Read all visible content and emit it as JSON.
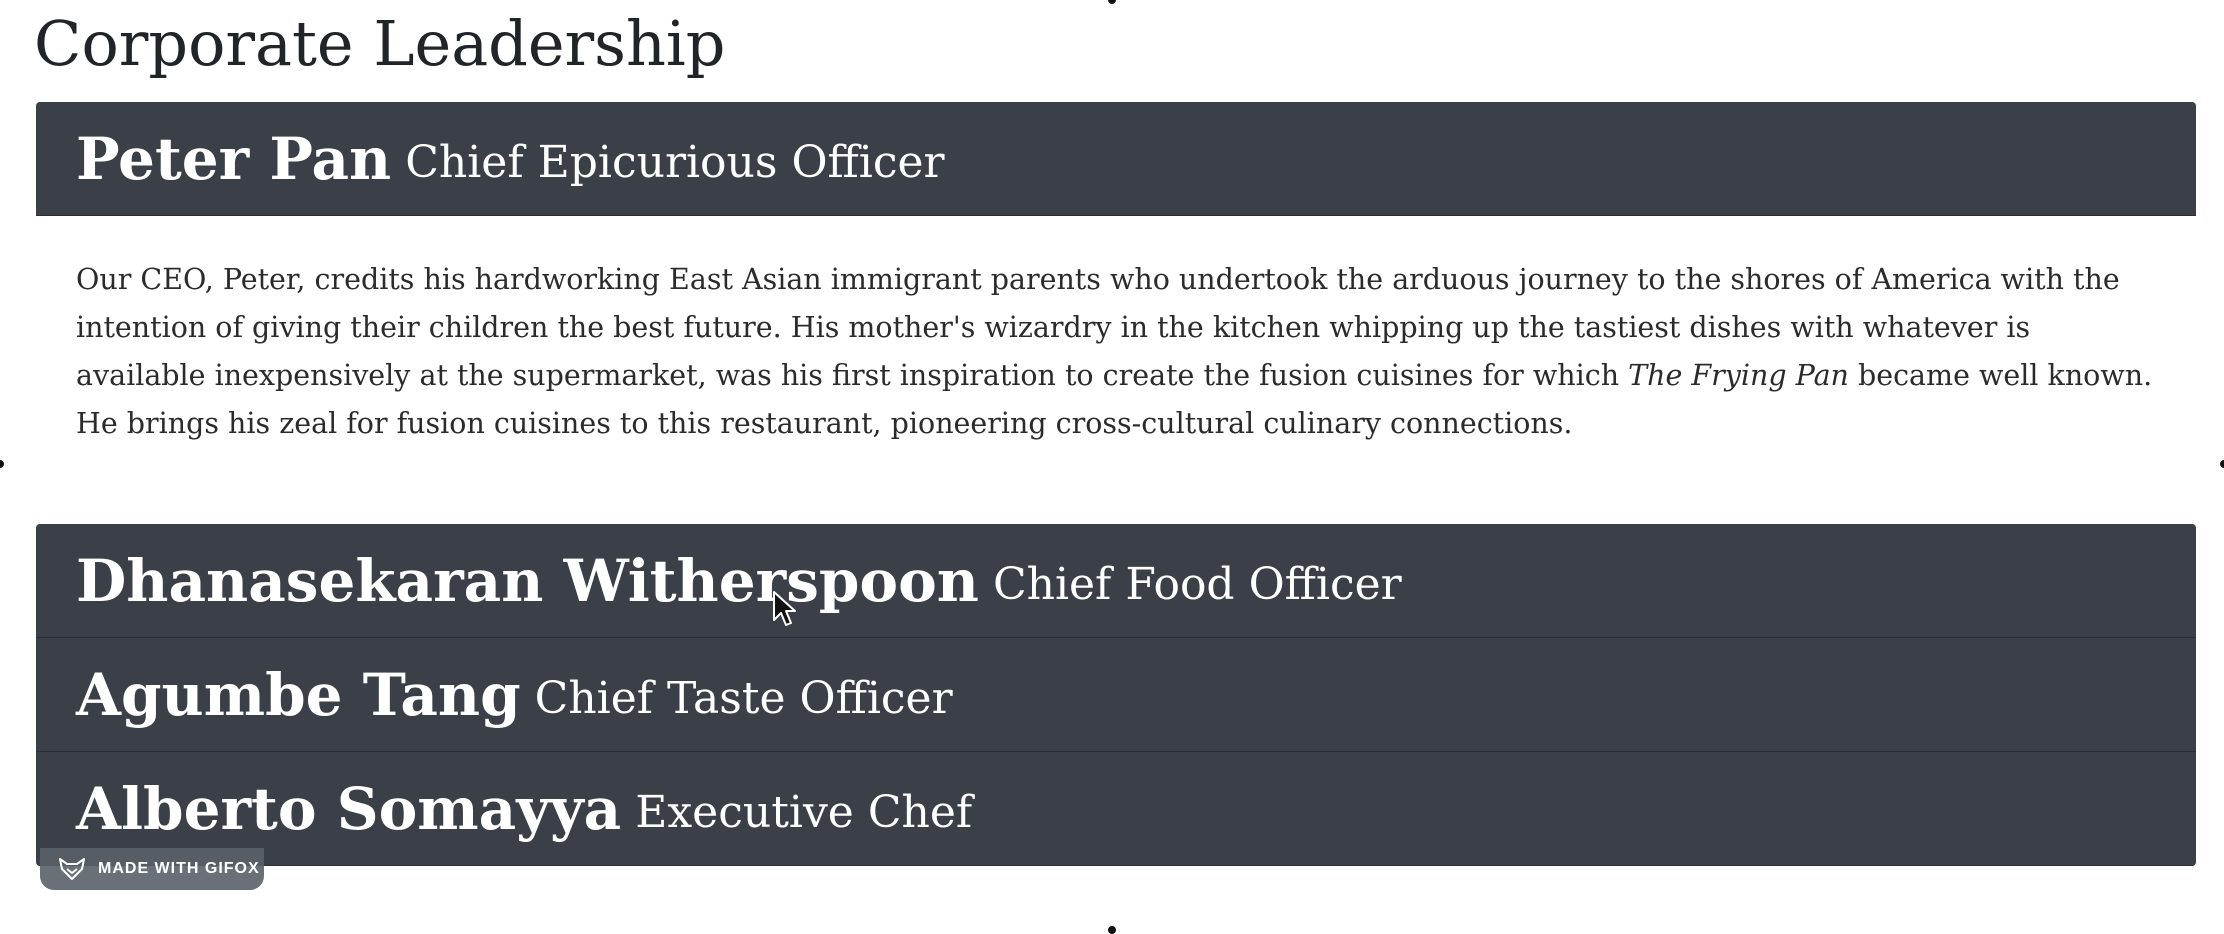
{
  "page": {
    "title": "Corporate Leadership"
  },
  "leaders": [
    {
      "name": "Peter Pan",
      "role": "Chief Epicurious Officer",
      "expanded": true,
      "bio_before": "Our CEO, Peter, credits his hardworking East Asian immigrant parents who undertook the arduous journey to the shores of America with the intention of giving their children the best future. His mother's wizardry in the kitchen whipping up the tastiest dishes with whatever is available inexpensively at the supermarket, was his first inspiration to create the fusion cuisines for which ",
      "bio_italic": "The Frying Pan",
      "bio_after": " became well known. He brings his zeal for fusion cuisines to this restaurant, pioneering cross-cultural culinary connections."
    },
    {
      "name": "Dhanasekaran Witherspoon",
      "role": "Chief Food Officer",
      "expanded": false
    },
    {
      "name": "Agumbe Tang",
      "role": "Chief Taste Officer",
      "expanded": false
    },
    {
      "name": "Alberto Somayya",
      "role": "Executive Chef",
      "expanded": false
    }
  ],
  "watermark": {
    "label": "MADE WITH GIFOX",
    "icon": "fox-icon"
  },
  "colors": {
    "header_bg": "#3b4048",
    "header_text": "#ffffff",
    "body_text": "#212529"
  }
}
